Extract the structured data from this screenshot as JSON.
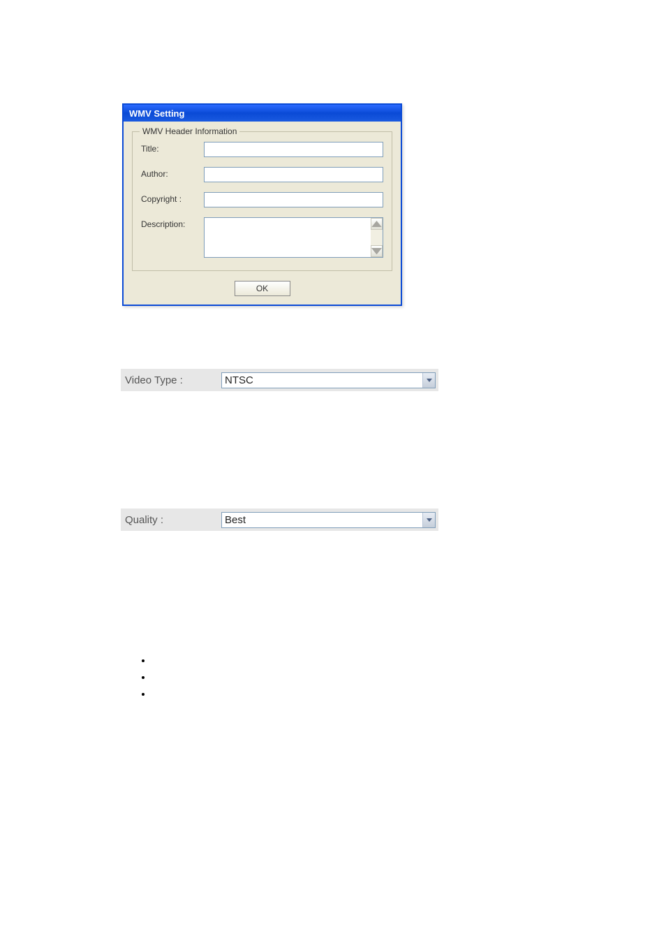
{
  "dialog": {
    "title": "WMV Setting",
    "groupbox_legend": "WMV Header Information",
    "fields": {
      "title": {
        "label": "Title:",
        "value": ""
      },
      "author": {
        "label": "Author:",
        "value": ""
      },
      "copyright": {
        "label": "Copyright :",
        "value": ""
      },
      "description": {
        "label": "Description:",
        "value": ""
      }
    },
    "ok_label": "OK"
  },
  "video_type": {
    "label": "Video Type :",
    "value": "NTSC"
  },
  "quality": {
    "label": "Quality :",
    "value": "Best"
  },
  "bullets": [
    "",
    "",
    ""
  ]
}
